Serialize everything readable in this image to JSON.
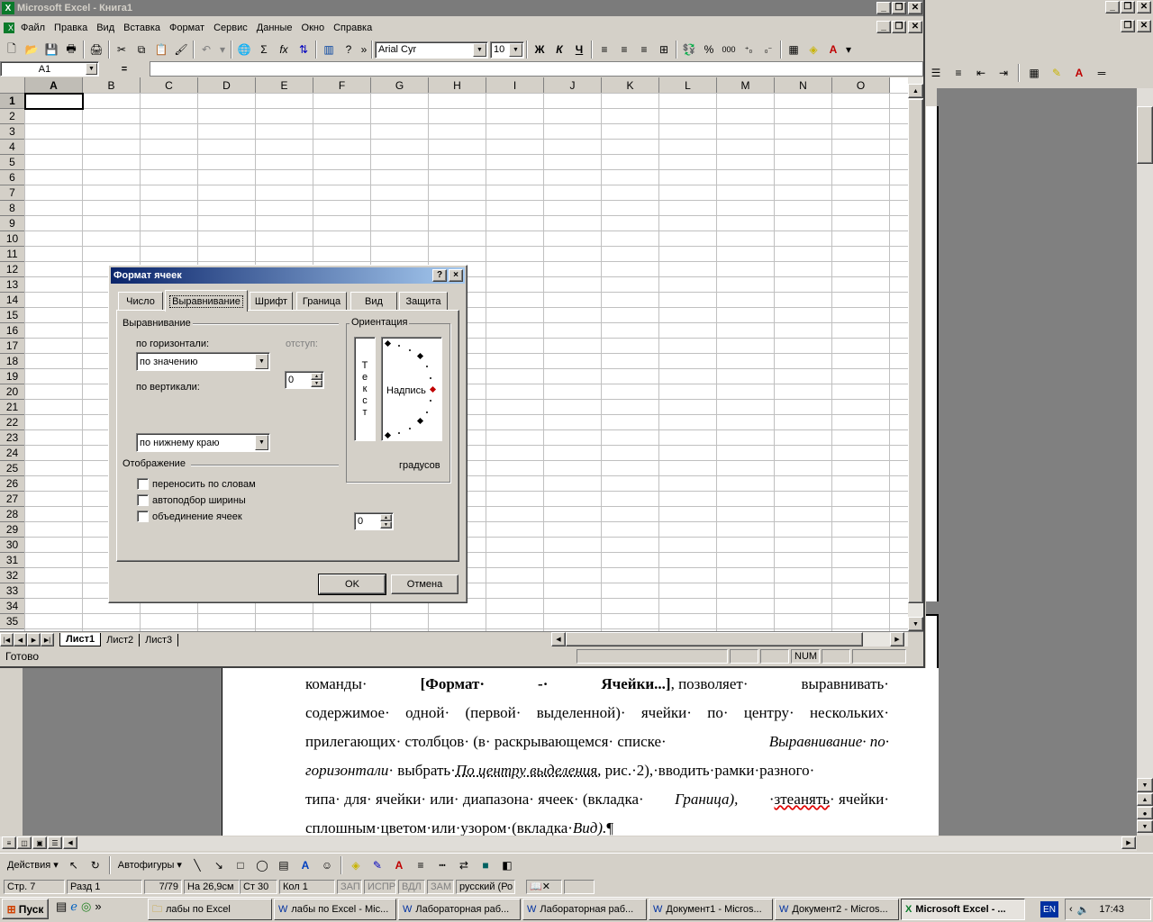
{
  "excel": {
    "title": "Microsoft Excel - Книга1",
    "menu": [
      "Файл",
      "Правка",
      "Вид",
      "Вставка",
      "Формат",
      "Сервис",
      "Данные",
      "Окно",
      "Справка"
    ],
    "font_name": "Arial Cyr",
    "font_size": "10",
    "bold": "Ж",
    "italic": "К",
    "underline": "Ч",
    "percent": "%",
    "thousands": "000",
    "sigma": "Σ",
    "fx": "fx",
    "name_box": "A1",
    "formula_eq": "=",
    "columns": [
      "A",
      "B",
      "C",
      "D",
      "E",
      "F",
      "G",
      "H",
      "I",
      "J",
      "K",
      "L",
      "M",
      "N",
      "O"
    ],
    "rows": [
      "1",
      "2",
      "3",
      "4",
      "5",
      "6",
      "7",
      "8",
      "9",
      "10",
      "11",
      "12",
      "13",
      "14",
      "15",
      "16",
      "17",
      "18",
      "19",
      "20",
      "21",
      "22",
      "23",
      "24",
      "25",
      "26",
      "27",
      "28",
      "29",
      "30",
      "31",
      "32",
      "33",
      "34",
      "35"
    ],
    "sheets": [
      "Лист1",
      "Лист2",
      "Лист3"
    ],
    "status_left": "Готово",
    "status_num": "NUM"
  },
  "dialog": {
    "title": "Формат ячеек",
    "help": "?",
    "close": "×",
    "tabs": [
      "Число",
      "Выравнивание",
      "Шрифт",
      "Граница",
      "Вид",
      "Защита"
    ],
    "alignment_group": "Выравнивание",
    "horizontal_label": "по горизонтали:",
    "horizontal_value": "по значению",
    "indent_label": "отступ:",
    "indent_value": "0",
    "vertical_label": "по вертикали:",
    "vertical_value": "по нижнему краю",
    "orientation_group": "Ориентация",
    "vertical_text": [
      "Т",
      "е",
      "к",
      "с",
      "т"
    ],
    "caption": "Надпись",
    "degrees_value": "0",
    "degrees_label": "градусов",
    "display_group": "Отображение",
    "wrap": "переносить по словам",
    "autofit": "автоподбор ширины",
    "merge": "объединение ячеек",
    "ok": "OK",
    "cancel": "Отмена"
  },
  "word": {
    "line1_a": "команды·",
    "line1_b": "[Формат·",
    "line1_c": "-·",
    "line1_d": "Ячейки...]",
    "line1_e": ", позволяет·",
    "line1_f": "выравнивать·",
    "line2": "содержимое· одной· (первой· выделенной)· ячейки· по· центру· нескольких·",
    "line3_a": "прилегающих· столбцов· (в· раскрывающемся· списке·",
    "line3_b": "Выравнивание· по·",
    "line4_a": "горизонтали",
    "line4_b": "· выбрать·",
    "line4_c": "По центру выделения,",
    "line4_d": " рис.·2),·вводить·рамки·разного·",
    "line5_a": "типа· для· ячейки· или· диапазона· ячеек· (вкладка·",
    "line5_b": "Граница),",
    "line5_c": "·",
    "line5_d": "зтеанять",
    "line5_e": "· ячейки·",
    "line6_a": "сплошным·цветом·или·узором·(вкладка·",
    "line6_b": "Вид).",
    "line6_c": "¶",
    "drawing_actions": "Действия",
    "autoshapes": "Автофигуры",
    "status": [
      "Стр. 7",
      "Разд 1",
      "7/79",
      "На 26,9см",
      "Ст 30",
      "Кол 1",
      "ЗАП",
      "ИСПР",
      "ВДЛ",
      "ЗАМ",
      "русский (Ро"
    ]
  },
  "taskbar": {
    "start": "Пуск",
    "items": [
      "лабы по Excel",
      "лабы по Excel - Mic...",
      "Лабораторная раб...",
      "Лабораторная раб...",
      "Документ1 - Micros...",
      "Документ2 - Micros...",
      "Microsoft Excel - ..."
    ],
    "lang": "EN",
    "time": "17:43"
  }
}
